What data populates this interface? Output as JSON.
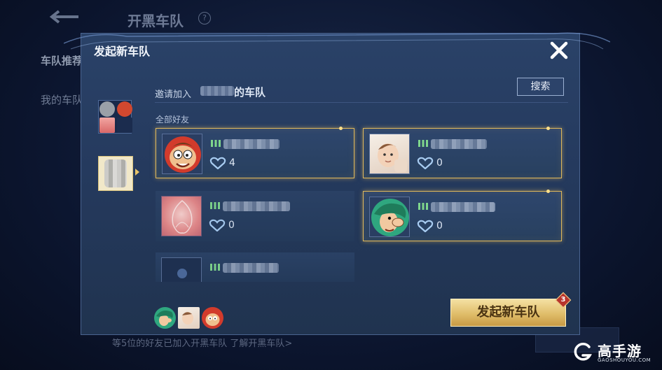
{
  "background": {
    "title": "开黑车队",
    "help_icon_glyph": "?",
    "tabs": [
      "车队推荐",
      "我的车队"
    ],
    "bottom_text": "等5位的好友已加入开黑车队 了解开黑车队>"
  },
  "dialog": {
    "title": "发起新车队",
    "invite_prefix": "邀请加入",
    "invite_suffix": "的车队",
    "search_label": "搜索",
    "section_label": "全部好友",
    "friends": [
      {
        "avatar": "cartoon-boy-avatar",
        "heart_count": "4",
        "selected": true
      },
      {
        "avatar": "baby-photo-avatar",
        "heart_count": "0",
        "selected": true
      },
      {
        "avatar": "pink-avatar",
        "heart_count": "0",
        "selected": false
      },
      {
        "avatar": "green-hair-cartoon-avatar",
        "heart_count": "0",
        "selected": true
      },
      {
        "avatar": "default-avatar",
        "heart_count": "",
        "selected": false
      }
    ],
    "selected_members": [
      "green-hair-cartoon-avatar",
      "baby-photo-avatar",
      "cartoon-boy-avatar"
    ],
    "launch_label": "发起新车队",
    "launch_badge": "3"
  },
  "watermark": {
    "text": "高手游",
    "sub": "GAOSHOUYOU.COM"
  },
  "colors": {
    "gold": "#e0b85a",
    "panel": "#253a5e",
    "rank_green": "#7fd68c"
  }
}
